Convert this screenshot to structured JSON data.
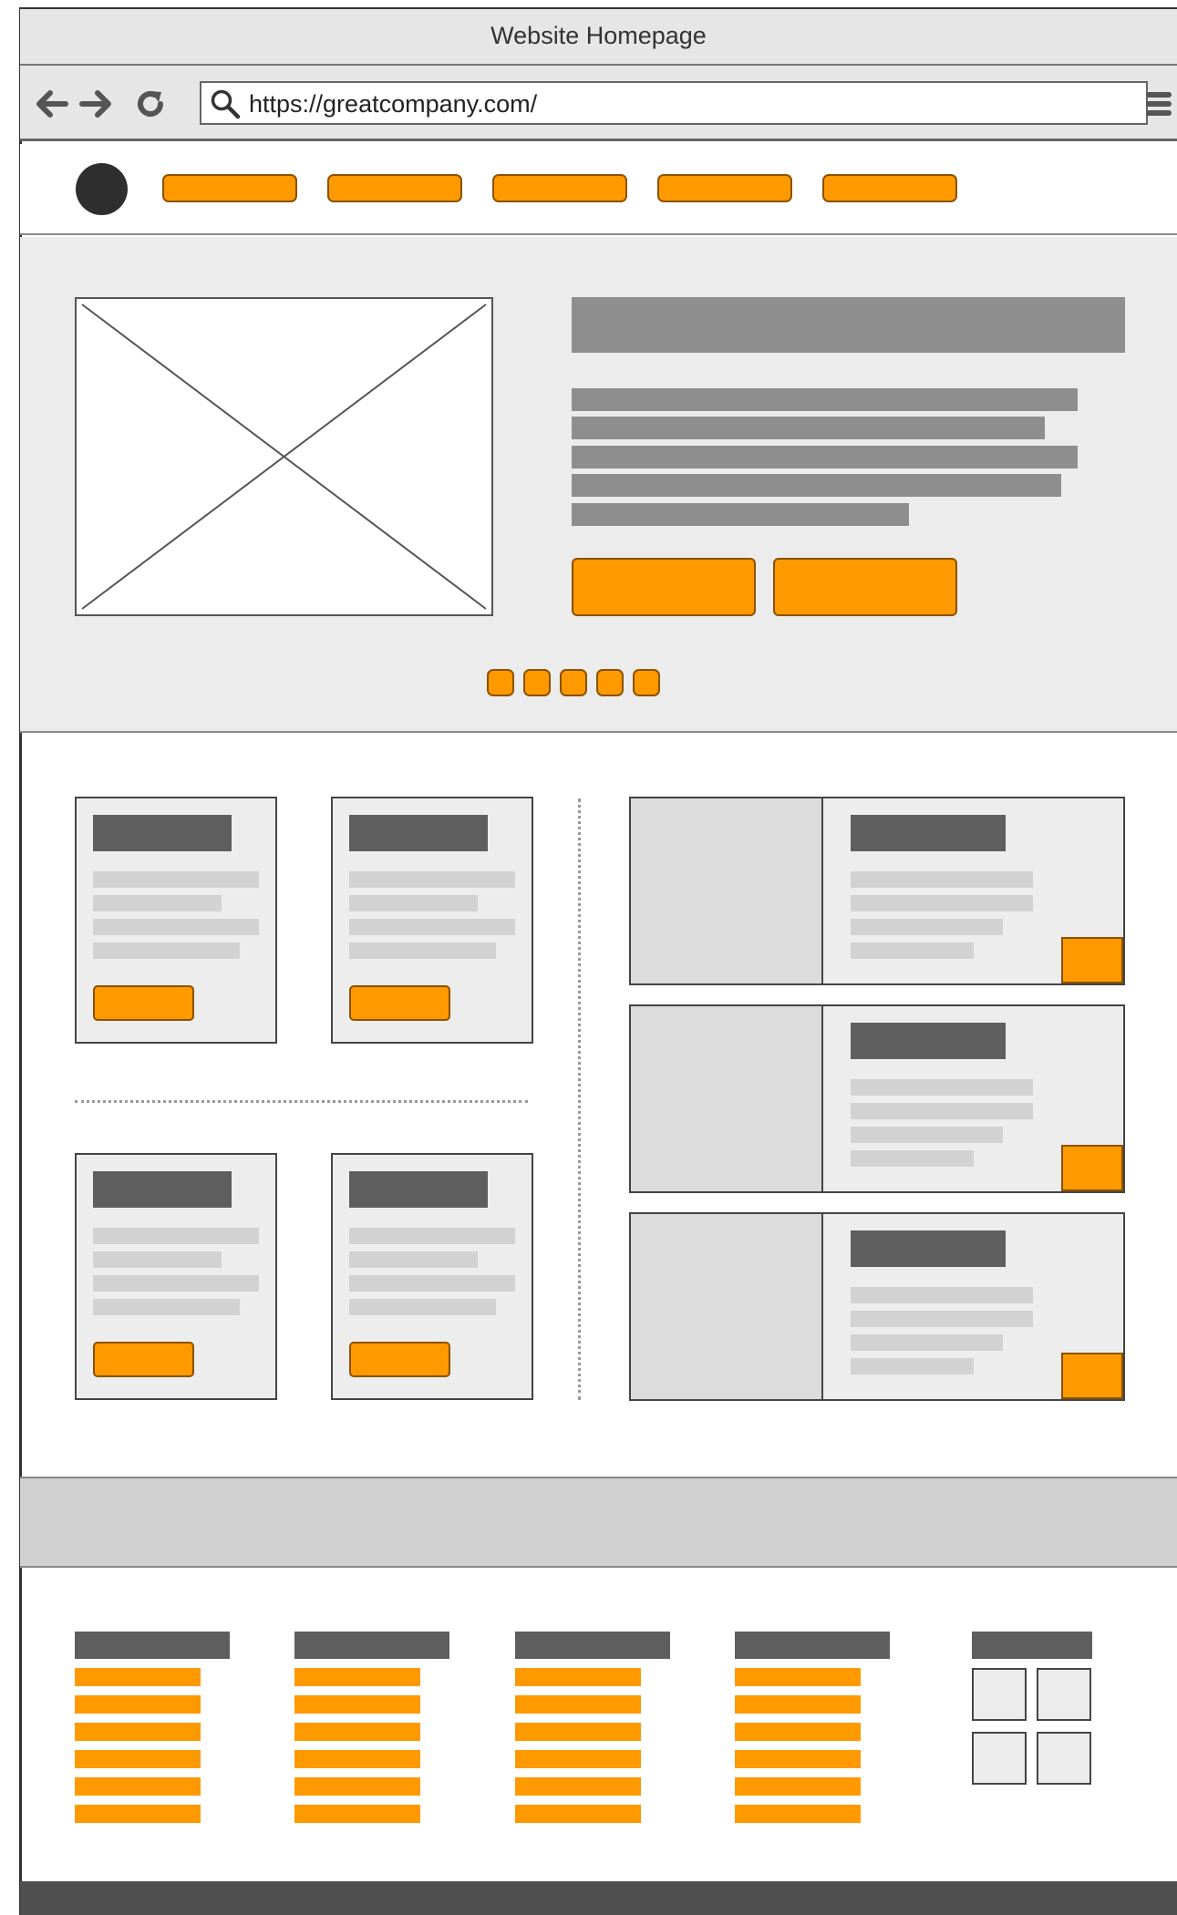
{
  "browser": {
    "window_title": "Website Homepage",
    "url": "https://greatcompany.com/"
  },
  "colors": {
    "accent": "#ff9900",
    "accent_border": "#8a5200",
    "dark_placeholder": "#5e5e5e",
    "mid_placeholder": "#8e8e8e",
    "light_placeholder": "#d2d2d2"
  },
  "icons": [
    "back-arrow-icon",
    "forward-arrow-icon",
    "reload-icon",
    "search-icon",
    "hamburger-menu-icon",
    "image-placeholder-icon"
  ]
}
